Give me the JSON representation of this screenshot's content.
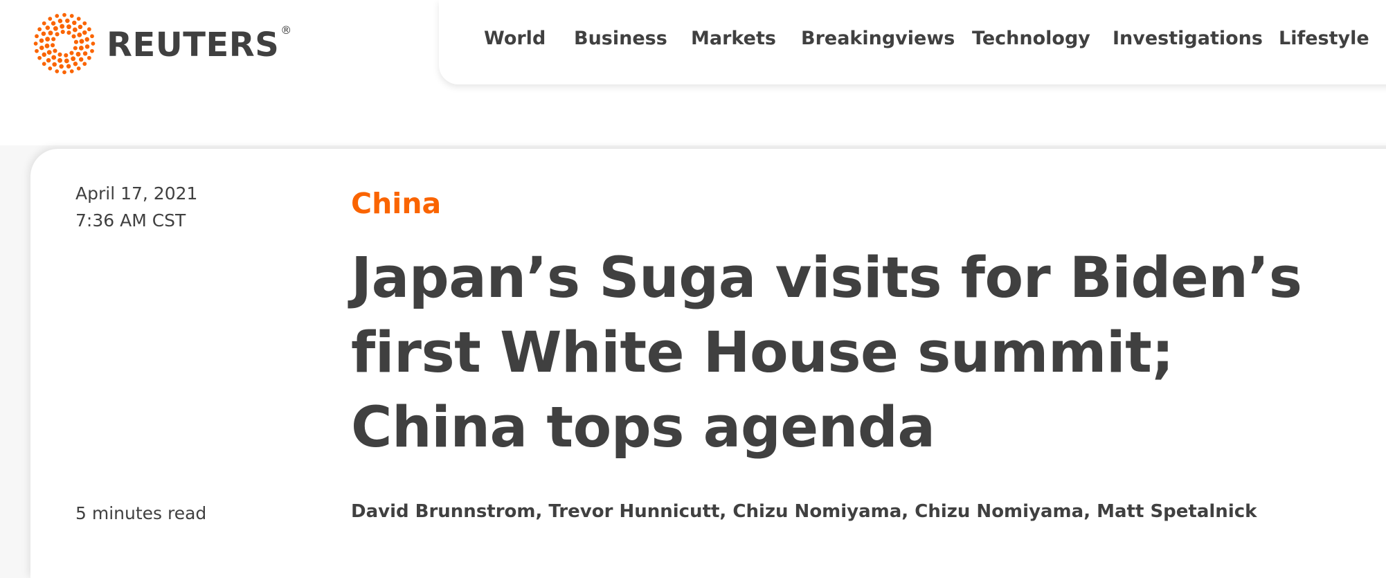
{
  "brand": {
    "name": "REUTERS",
    "registered_mark": "®",
    "accent_color": "#fa6400",
    "logo_icon": "reuters-dot-circle-logo"
  },
  "nav": {
    "items": [
      {
        "label": "World"
      },
      {
        "label": "Business"
      },
      {
        "label": "Markets"
      },
      {
        "label": "Breakingviews"
      },
      {
        "label": "Technology"
      },
      {
        "label": "Investigations"
      },
      {
        "label": "Lifestyle"
      }
    ]
  },
  "article": {
    "date": "April 17, 2021",
    "time": "7:36 AM CST",
    "read_time": "5 minutes read",
    "category": "China",
    "headline_lines": [
      "Japan’s Suga visits for Biden’s",
      "first White House summit;",
      "China tops agenda"
    ],
    "byline": "David Brunnstrom, Trevor Hunnicutt, Chizu Nomiyama, Chizu Nomiyama, Matt Spetalnick"
  },
  "colors": {
    "text": "#404040",
    "category": "#fa6400",
    "page_background": "#f7f7f7",
    "card_background": "#ffffff"
  }
}
